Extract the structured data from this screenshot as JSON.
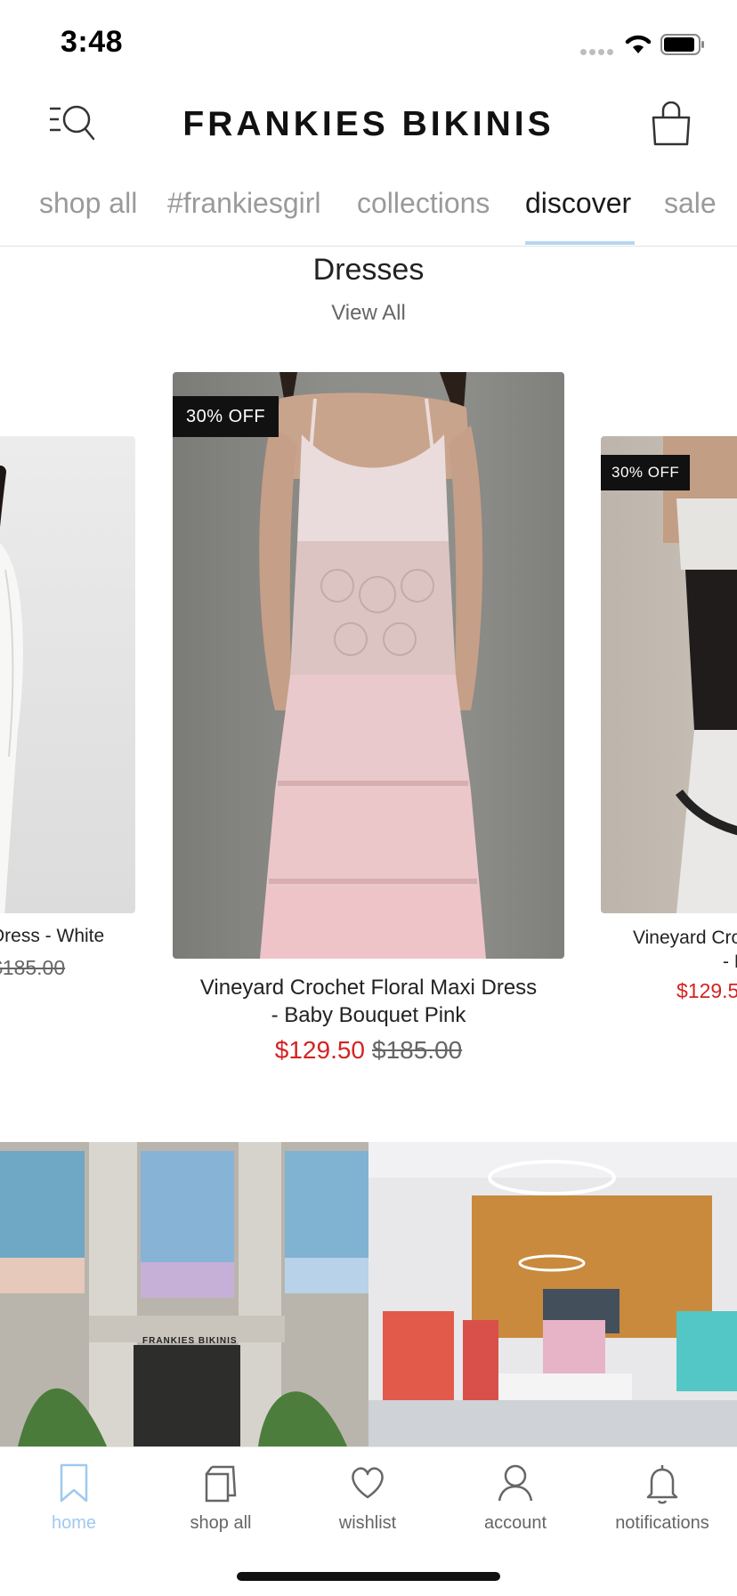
{
  "status_bar": {
    "time": "3:48"
  },
  "header": {
    "brand": "FRANKIES BIKINIS"
  },
  "tabs": [
    {
      "label": "shop all",
      "active": false
    },
    {
      "label": "#frankiesgirl",
      "active": false
    },
    {
      "label": "collections",
      "active": false
    },
    {
      "label": "discover",
      "active": true
    },
    {
      "label": "sale",
      "active": false
    }
  ],
  "section": {
    "title": "Dresses",
    "view_all": "View All"
  },
  "products": [
    {
      "name": "Dress - White",
      "orig_price": "$185.00"
    },
    {
      "badge": "30% OFF",
      "name_line1": "Vineyard Crochet Floral Maxi Dress",
      "name_line2": "- Baby Bouquet Pink",
      "sale_price": "$129.50",
      "orig_price": "$185.00"
    },
    {
      "badge": "30% OFF",
      "name_line1": "Vineyard Cro",
      "name_line2": "- M",
      "sale_price": "$129.5"
    }
  ],
  "store_sign": "FRANKIES BIKINIS",
  "bottom_nav": [
    {
      "label": "home",
      "icon": "bookmark-icon",
      "active": true
    },
    {
      "label": "shop all",
      "icon": "shopping-bags-icon",
      "active": false
    },
    {
      "label": "wishlist",
      "icon": "heart-icon",
      "active": false
    },
    {
      "label": "account",
      "icon": "person-icon",
      "active": false
    },
    {
      "label": "notifications",
      "icon": "bell-icon",
      "active": false
    }
  ],
  "colors": {
    "accent": "#9fc9ef",
    "sale": "#d42323",
    "badge_bg": "#111111"
  }
}
